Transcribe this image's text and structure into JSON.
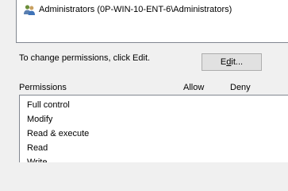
{
  "group_list": {
    "items": [
      {
        "label": "Administrators (0P-WIN-10-ENT-6\\Administrators)",
        "icon": "users-group-icon"
      }
    ]
  },
  "change_permissions_text": "To change permissions, click Edit.",
  "edit_button": {
    "label_prefix": "E",
    "label_mnemonic": "d",
    "label_suffix": "it..."
  },
  "permissions": {
    "header": "Permissions",
    "allow_header": "Allow",
    "deny_header": "Deny",
    "items": [
      {
        "label": "Full control"
      },
      {
        "label": "Modify"
      },
      {
        "label": "Read & execute"
      },
      {
        "label": "Read"
      },
      {
        "label": "Write"
      }
    ]
  }
}
